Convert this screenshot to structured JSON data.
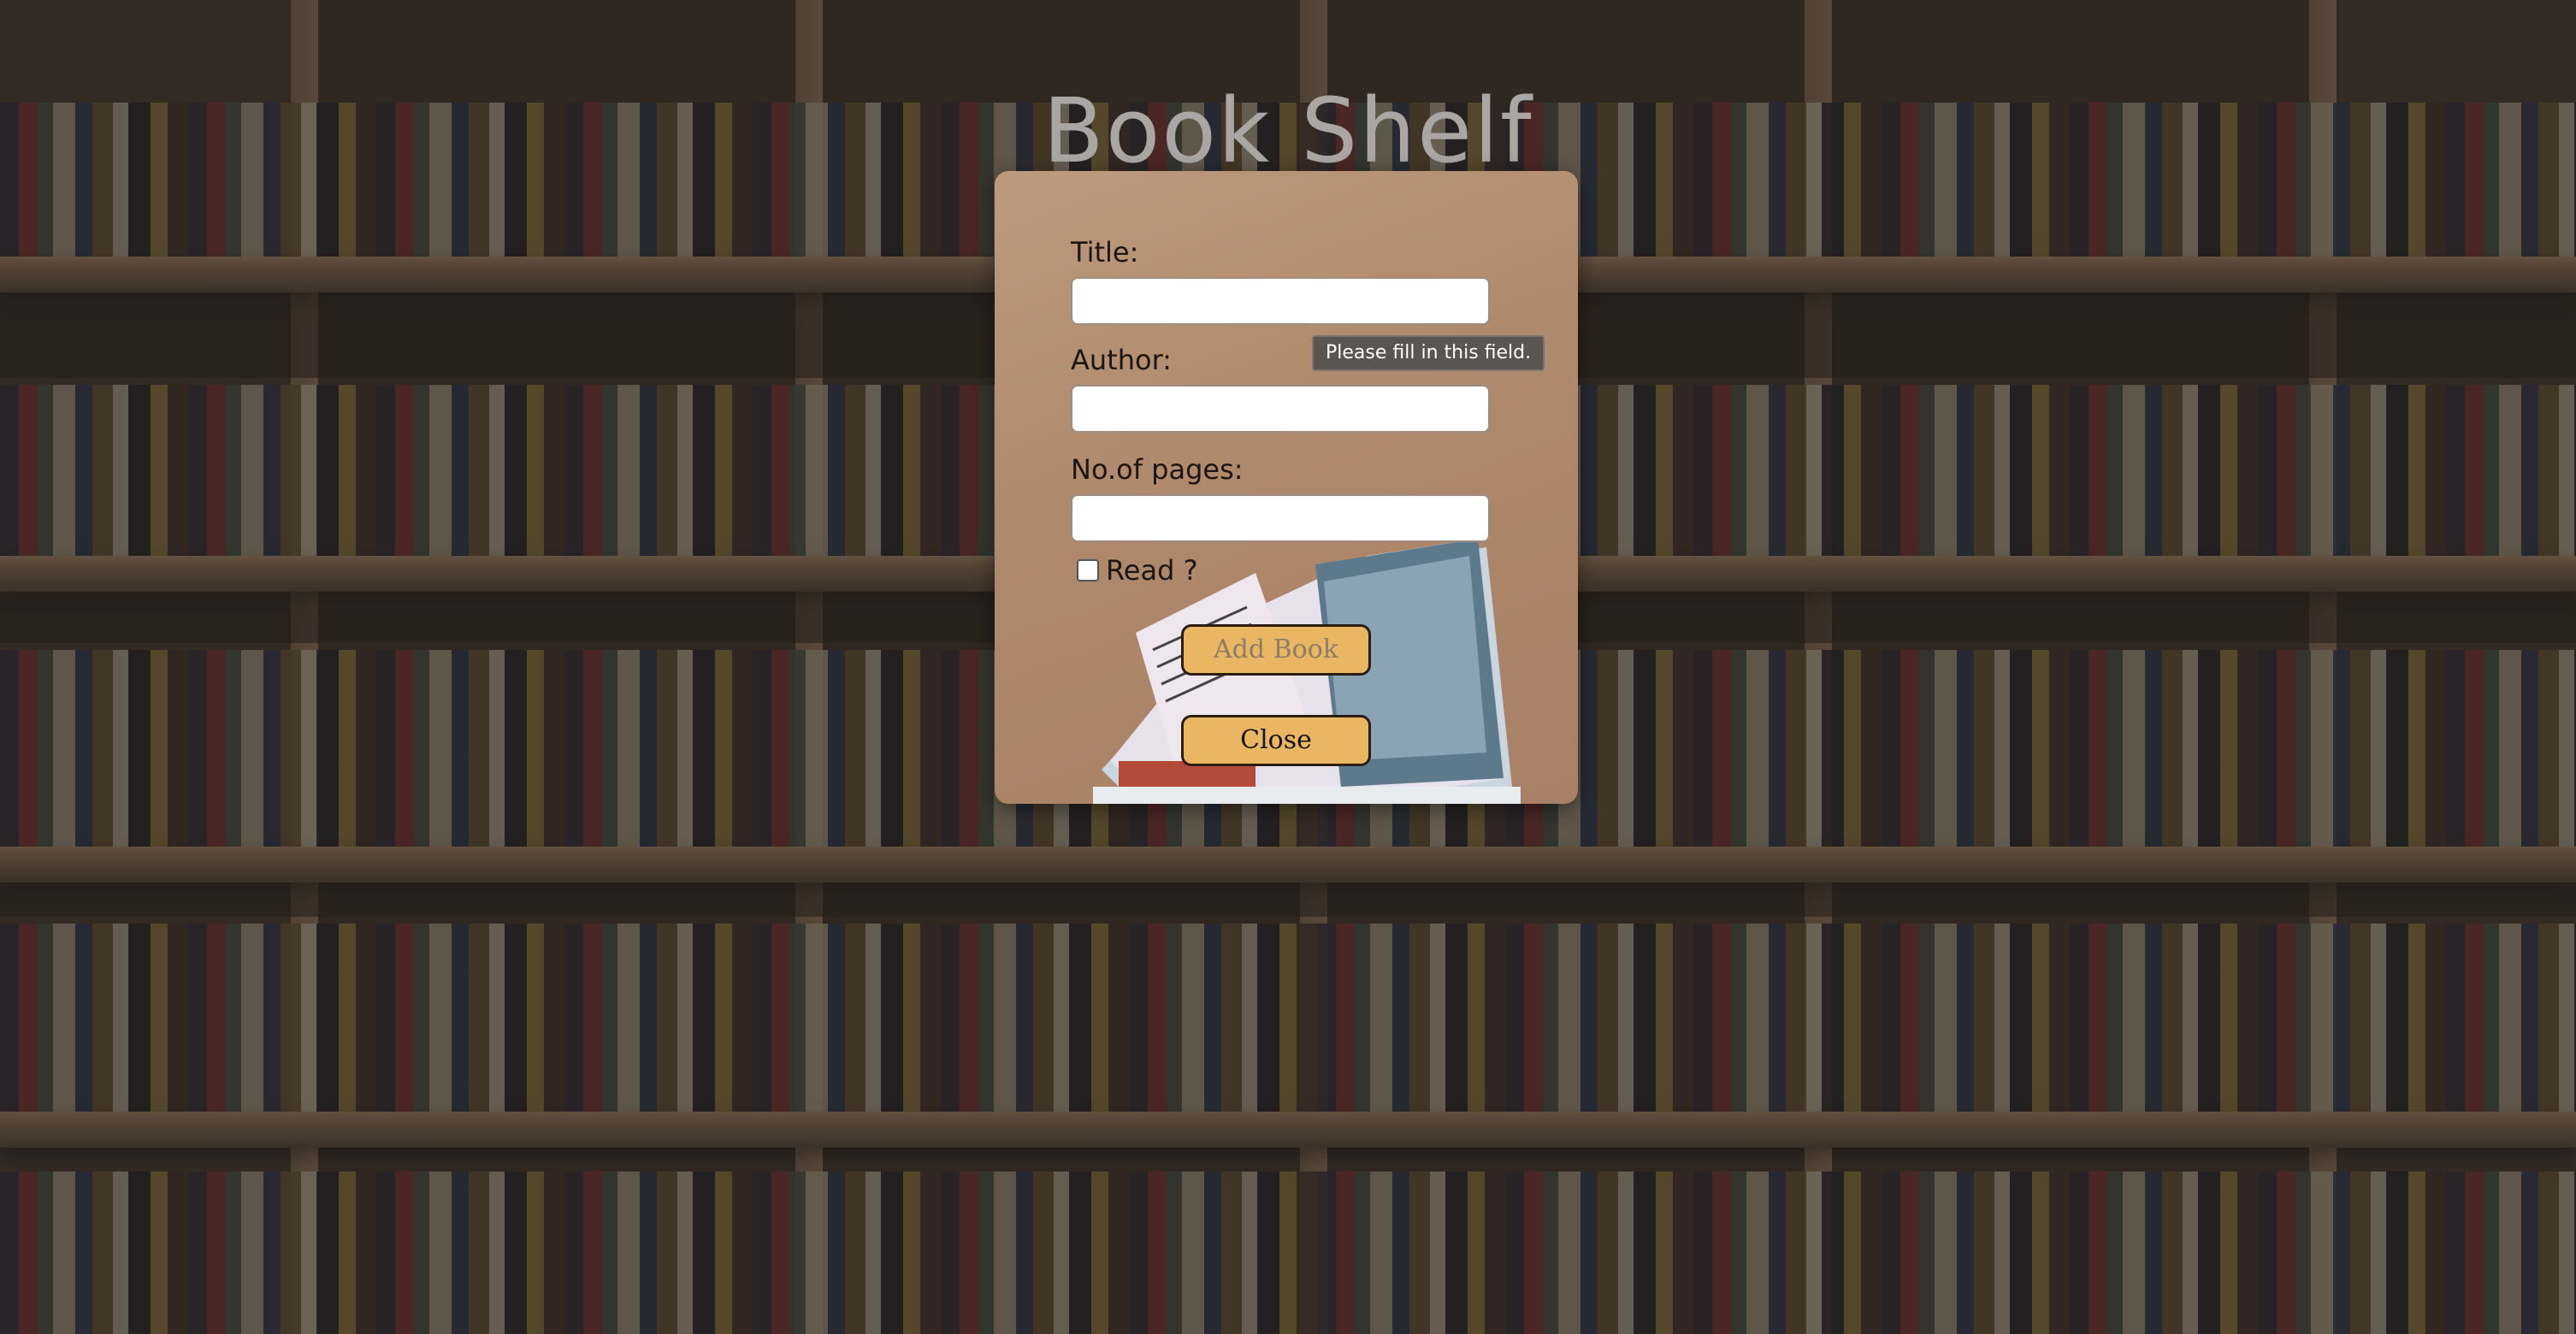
{
  "page": {
    "title": "Book Shelf"
  },
  "form": {
    "title_label": "Title:",
    "title_value": "",
    "author_label": "Author:",
    "author_value": "",
    "pages_label": "No.of pages:",
    "pages_value": "",
    "read_label": "Read ?",
    "read_checked": false,
    "add_button": "Add Book",
    "close_button": "Close"
  },
  "tooltip": {
    "message": "Please fill in this field."
  },
  "colors": {
    "card": "#b08a6c",
    "button": "#e9b764",
    "title_text": "#a9a6a3"
  }
}
